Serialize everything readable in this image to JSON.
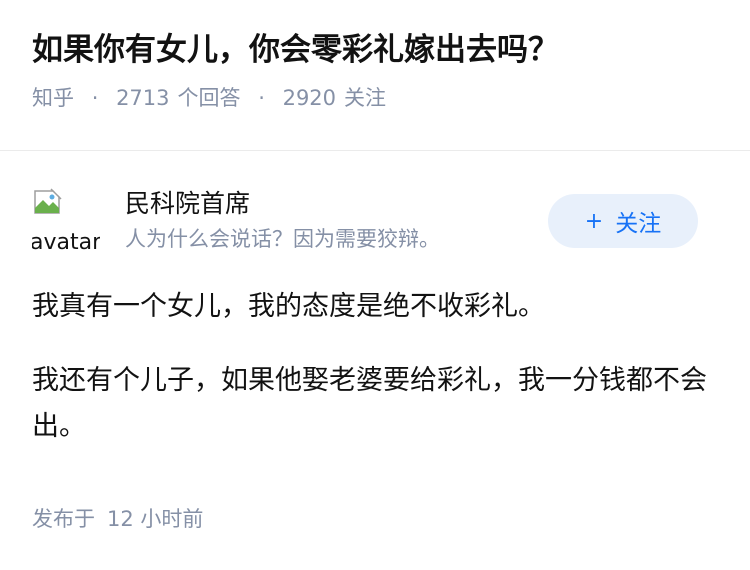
{
  "question": {
    "title": "如果你有女儿，你会零彩礼嫁出去吗？",
    "source": "知乎",
    "separator": "·",
    "answer_count": "2713",
    "answer_label": "个回答",
    "follower_count": "2920",
    "follower_label": "关注"
  },
  "author": {
    "avatar_alt": "avatar",
    "name": "民科院首席",
    "bio": "人为什么会说话？因为需要狡辩。",
    "follow_icon": "+",
    "follow_label": "关注"
  },
  "answer": {
    "paragraphs": [
      "我真有一个女儿，我的态度是绝不收彩礼。",
      "我还有个儿子，如果他娶老婆要给彩礼，我一分钱都不会出。"
    ],
    "published_label": "发布于",
    "published_time": "12 小时前"
  },
  "colors": {
    "meta_gray": "#8590a6",
    "accent_blue": "#1772f6",
    "follow_bg": "#e8f0fb",
    "text": "#121212"
  }
}
